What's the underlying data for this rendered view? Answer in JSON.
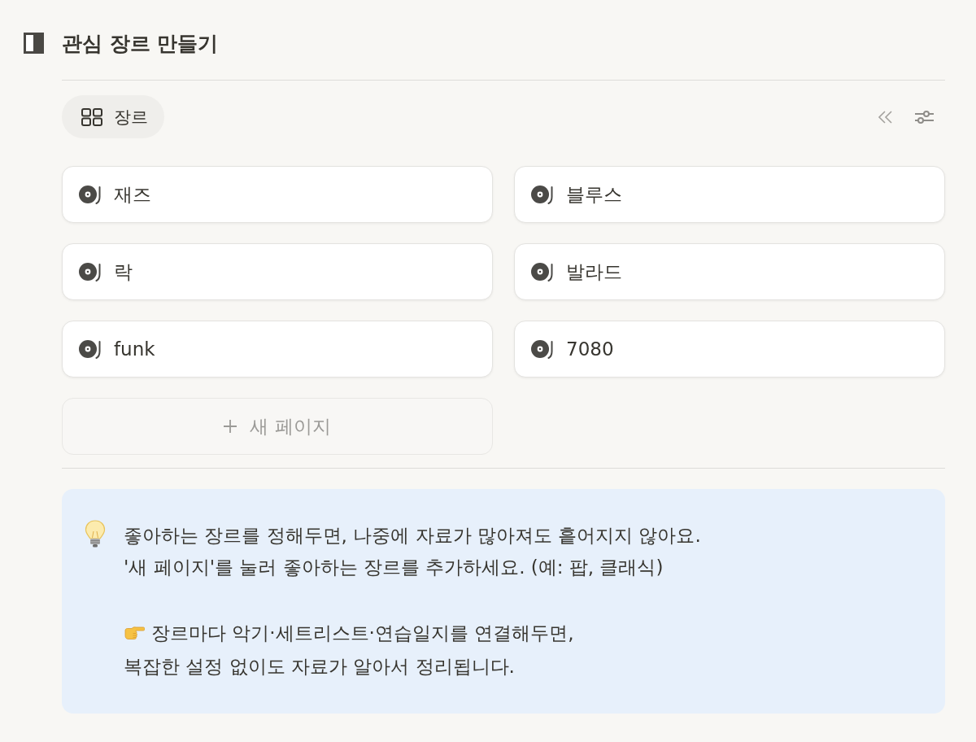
{
  "page": {
    "title": "관심 장르 만들기"
  },
  "views": [
    {
      "label": "장르",
      "selected": true
    }
  ],
  "genres": [
    {
      "title": "재즈"
    },
    {
      "title": "블루스"
    },
    {
      "title": "락"
    },
    {
      "title": "발라드"
    },
    {
      "title": "funk"
    },
    {
      "title": "7080"
    }
  ],
  "new_page_button": {
    "label": "새 페이지"
  },
  "callout": {
    "paragraphs": [
      {
        "kind": "plain",
        "lines": [
          "좋아하는 장르를 정해두면, 나중에 자료가 많아져도 흩어지지 않아요.",
          "'새 페이지'를 눌러 좋아하는 장르를 추가하세요. (예: 팝, 클래식)"
        ]
      },
      {
        "kind": "pointer",
        "lines": [
          "장르마다 악기·세트리스트·연습일지를 연결해두면,",
          "복잡한 설정 없이도 자료가 알아서 정리됩니다."
        ]
      }
    ]
  }
}
